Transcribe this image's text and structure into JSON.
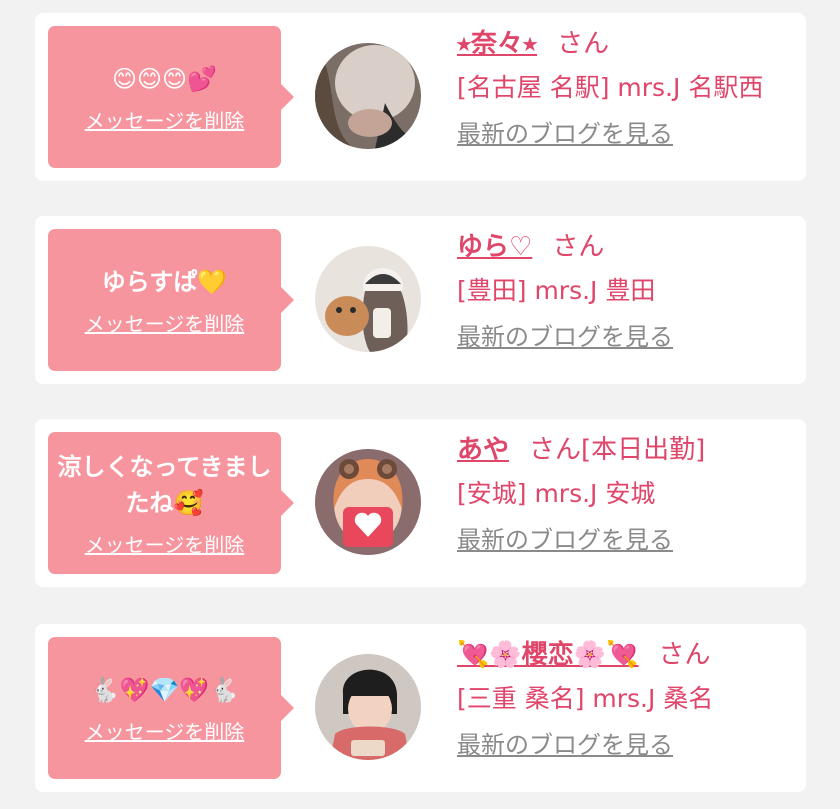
{
  "favorites": [
    {
      "message": "😊😊😊💕",
      "delete_label": "メッセージを削除",
      "name": "⭑奈々⭑",
      "honorific": "さん",
      "status": "",
      "shop": "[名古屋 名駅] mrs.J 名駅西",
      "blog_link": "最新のブログを見る"
    },
    {
      "message": "ゆらすぱ💛",
      "delete_label": "メッセージを削除",
      "name": "ゆら♡",
      "honorific": "さん",
      "status": "",
      "shop": "[豊田] mrs.J 豊田",
      "blog_link": "最新のブログを見る"
    },
    {
      "message": "涼しくなってきましたね🥰",
      "delete_label": "メッセージを削除",
      "name": "あや",
      "honorific": "さん",
      "status": "[本日出勤]",
      "shop": "[安城] mrs.J 安城",
      "blog_link": "最新のブログを見る"
    },
    {
      "message": "🐇💖💎💖🐇",
      "delete_label": "メッセージを削除",
      "name": "💘🌸櫻恋🌸💘",
      "honorific": "さん",
      "status": "",
      "shop": "[三重 桑名] mrs.J 桑名",
      "blog_link": "最新のブログを見る"
    }
  ]
}
